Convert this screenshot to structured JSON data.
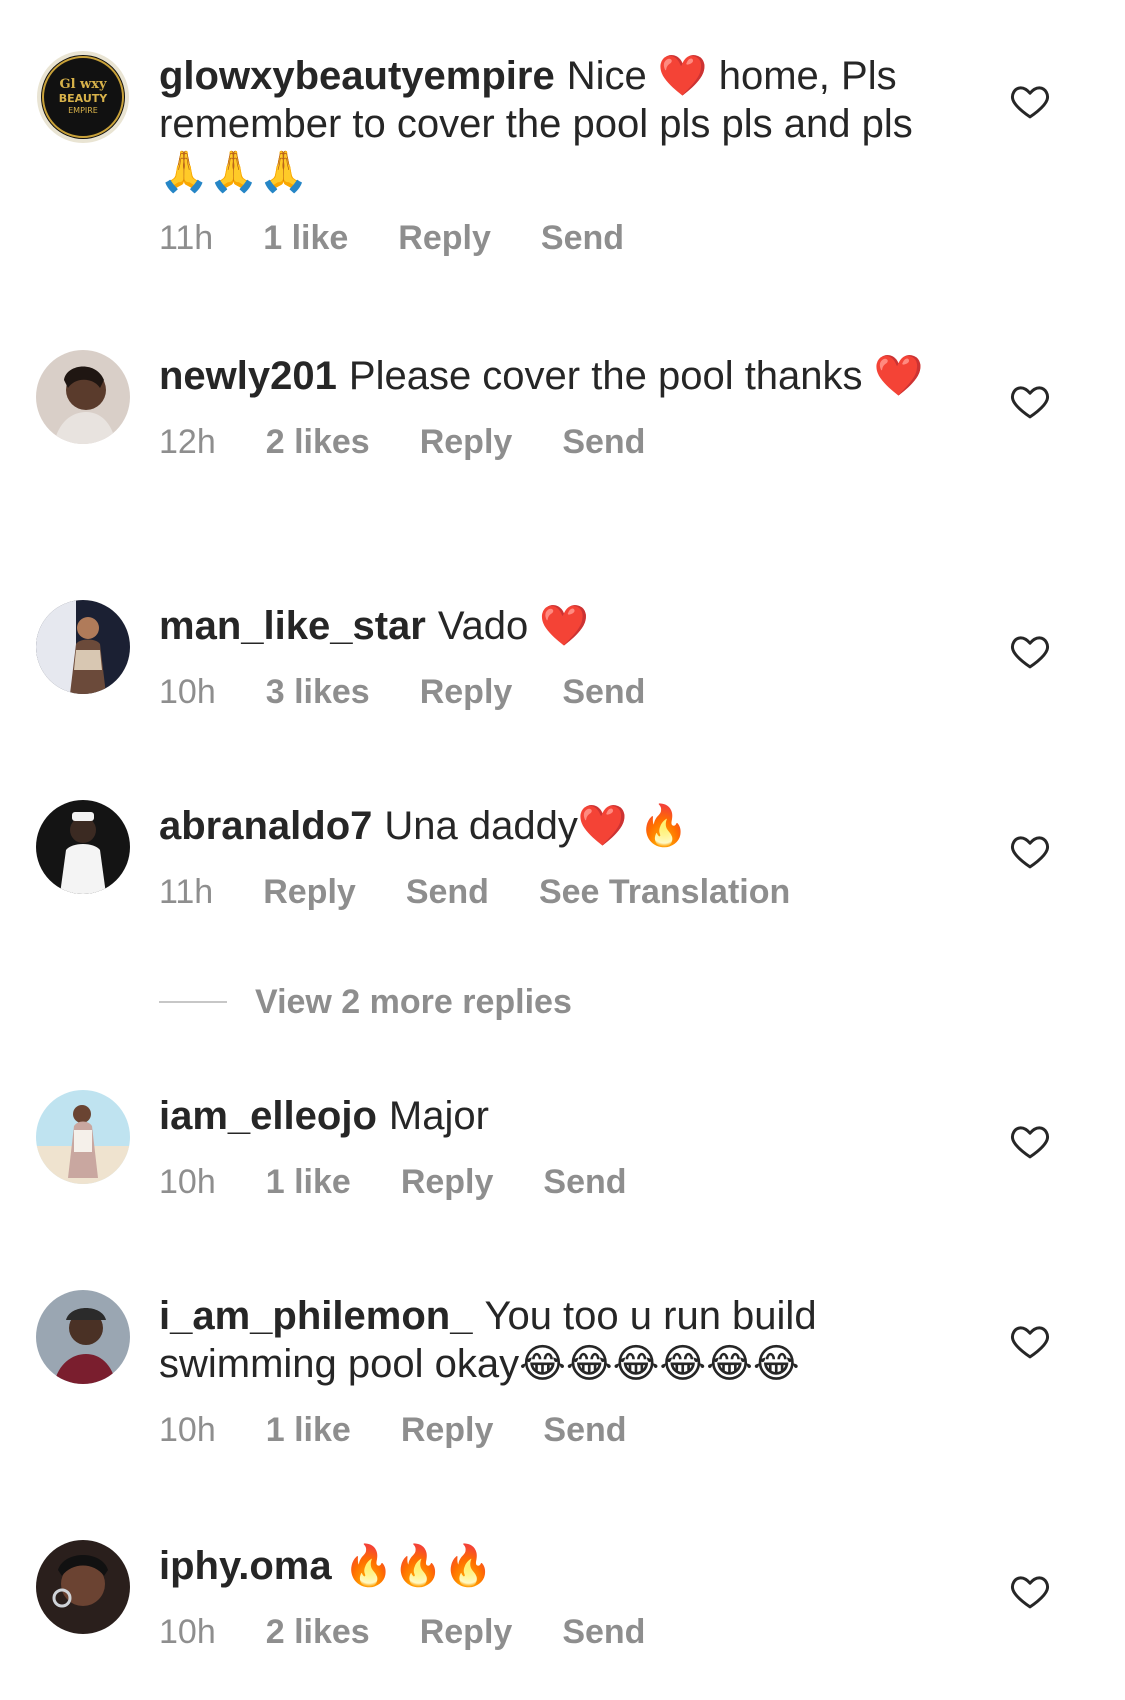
{
  "comments": [
    {
      "username": "glowxybeautyempire",
      "text": "Nice ❤️ home, Pls remember to cover the pool pls pls and pls 🙏🙏🙏",
      "time": "11h",
      "likes": "1 like",
      "reply": "Reply",
      "send": "Send",
      "avatar_logo_text": "Gl wxy BEAUTY EMPIRE"
    },
    {
      "username": "newly201",
      "text": "Please cover the pool thanks ❤️",
      "time": "12h",
      "likes": "2 likes",
      "reply": "Reply",
      "send": "Send"
    },
    {
      "username": "man_like_star",
      "text": "Vado ❤️",
      "time": "10h",
      "likes": "3 likes",
      "reply": "Reply",
      "send": "Send"
    },
    {
      "username": "abranaldo7",
      "text": "Una daddy❤️ 🔥",
      "time": "11h",
      "reply": "Reply",
      "send": "Send",
      "translation": "See Translation"
    },
    {
      "username": "iam_elleojo",
      "text": "Major",
      "time": "10h",
      "likes": "1 like",
      "reply": "Reply",
      "send": "Send"
    },
    {
      "username": "i_am_philemon_",
      "text": "You too u run build swimming pool okay😂😂😂😂😂😂",
      "time": "10h",
      "likes": "1 like",
      "reply": "Reply",
      "send": "Send"
    },
    {
      "username": "iphy.oma",
      "text": "🔥🔥🔥",
      "time": "10h",
      "likes": "2 likes",
      "reply": "Reply",
      "send": "Send"
    }
  ],
  "view_more_replies": "View 2 more replies",
  "icons": {
    "like": "heart-outline-icon"
  },
  "colors": {
    "text": "#262626",
    "meta": "#8e8e8e",
    "heart": "#e0112b"
  }
}
